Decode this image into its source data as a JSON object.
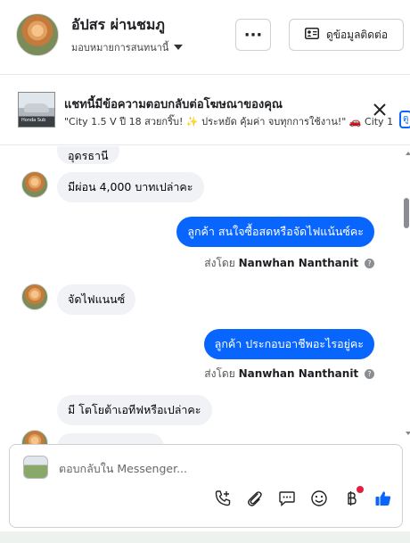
{
  "header": {
    "contact_name": "อัปสร ผ่านชมภู",
    "assignment": "มอบหมายการสนทนานี้",
    "more_label": "···",
    "contact_info_label": "ดูข้อมูลติดต่อ"
  },
  "ad_banner": {
    "title": "แชทนี้มีข้อความตอบกลับต่อโฆษณาของคุณ",
    "text": "\"City 1.5 V ปี 18 สวยกริ๊บ! ✨ ประหยัด คุ้มค่า จบทุกการใช้งาน!\" 🚗 City 1.5 V",
    "thumb_caption": "Honda Sub",
    "edge_label": "ดู"
  },
  "messages": [
    {
      "id": "m1",
      "direction": "in",
      "text": "อุดรธานี"
    },
    {
      "id": "m2",
      "direction": "in",
      "text": "มีผ่อน 4,000 บาทเปล่าคะ"
    },
    {
      "id": "m3",
      "direction": "out",
      "text": "ลูกค้า สนใจซื้อสดหรือจัดไฟแน้นซ์คะ",
      "sent_by_prefix": "ส่งโดย",
      "sent_by_name": "Nanwhan Nanthanit"
    },
    {
      "id": "m4",
      "direction": "in",
      "text": "จัดไฟแนนซ์"
    },
    {
      "id": "m5",
      "direction": "out",
      "text": "ลูกค้า ประกอบอาชีพอะไรอยู่คะ",
      "sent_by_prefix": "ส่งโดย",
      "sent_by_name": "Nanwhan Nanthanit"
    },
    {
      "id": "m6",
      "direction": "in",
      "text": "มี โตโยต้าเอทีฟหรือเปล่าคะ"
    }
  ],
  "composer": {
    "placeholder": "ตอบกลับใน Messenger..."
  },
  "toolbar_icons": [
    "call-icon",
    "attachment-icon",
    "saved-replies-icon",
    "emoji-icon",
    "payment-baht-icon",
    "like-icon"
  ],
  "colors": {
    "outgoing_bubble": "#0866ff",
    "incoming_bubble": "#f0f2f5",
    "notification_dot": "#e41e3f",
    "like_icon": "#0866ff"
  }
}
